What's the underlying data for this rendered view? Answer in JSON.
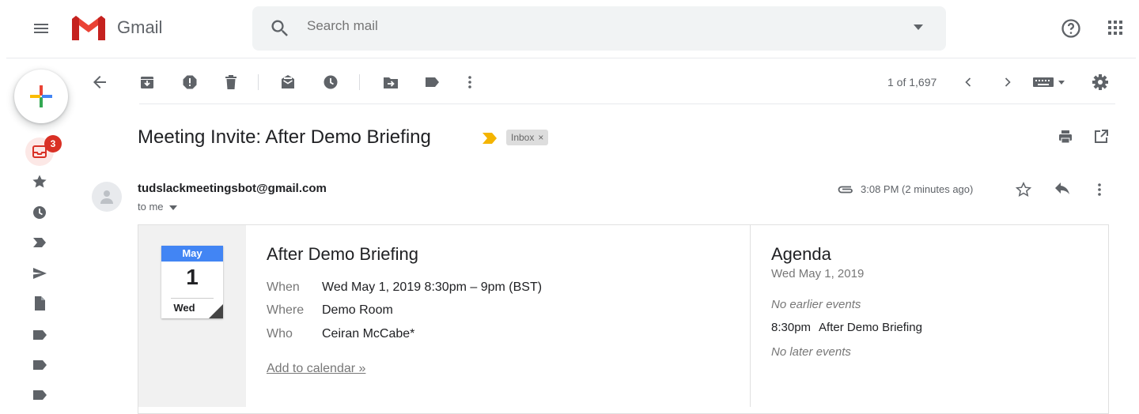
{
  "app": {
    "name": "Gmail",
    "brand_colors": {
      "red": "#ea4335",
      "blue": "#4285f4",
      "green": "#34a853",
      "yellow": "#fbbc04"
    }
  },
  "search": {
    "placeholder": "Search mail"
  },
  "icons": {
    "top": [
      "menu-icon",
      "gmail-logo",
      "search-icon",
      "chevron-down-icon",
      "help-icon",
      "apps-icon"
    ],
    "toolbar": [
      "back-arrow-icon",
      "archive-icon",
      "report-spam-icon",
      "delete-icon",
      "mark-unread-icon",
      "snooze-icon",
      "move-to-icon",
      "labels-icon",
      "more-vert-icon",
      "chevron-left-icon",
      "chevron-right-icon",
      "keyboard-icon",
      "settings-icon"
    ],
    "nav": [
      "compose-plus-icon",
      "inbox-icon",
      "star-icon",
      "snoozed-clock-icon",
      "important-icon",
      "sent-icon",
      "drafts-icon",
      "label-icon",
      "label-icon",
      "label-icon"
    ]
  },
  "nav": {
    "inbox_unread_count": "3"
  },
  "toolbar": {
    "count": "1 of 1,697"
  },
  "message": {
    "subject": "Meeting Invite: After Demo Briefing",
    "label_chip": "Inbox",
    "label_chip_remove": "×",
    "sender": "tudslackmeetingsbot@gmail.com",
    "recipient": "to me",
    "time": "3:08 PM (2 minutes ago)"
  },
  "invite": {
    "calendar": {
      "month": "May",
      "day": "1",
      "weekday": "Wed",
      "month_color": "#4285f4"
    },
    "title": "After Demo Briefing",
    "rows": [
      {
        "label": "When",
        "value": "Wed May 1, 2019 8:30pm – 9pm (BST)"
      },
      {
        "label": "Where",
        "value": "Demo Room"
      },
      {
        "label": "Who",
        "value": "Ceiran McCabe*"
      }
    ],
    "add_to_calendar": "Add to calendar »"
  },
  "agenda": {
    "title": "Agenda",
    "date": "Wed May 1, 2019",
    "before": "No earlier events",
    "event_time": "8:30pm",
    "event_title": "After Demo Briefing",
    "after": "No later events"
  }
}
